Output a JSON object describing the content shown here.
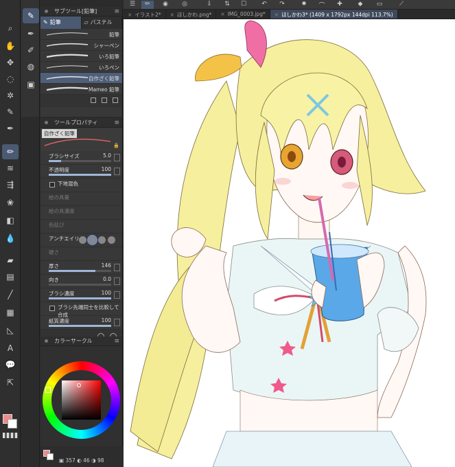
{
  "toolbar": {
    "tools": [
      {
        "icon": "magnifier-icon",
        "glyph": "⌕"
      },
      {
        "icon": "hand-icon",
        "glyph": "✋"
      },
      {
        "icon": "move-icon",
        "glyph": "✥"
      },
      {
        "icon": "lasso-icon",
        "glyph": "◌"
      },
      {
        "icon": "magic-wand-icon",
        "glyph": "✲"
      },
      {
        "icon": "eyedropper-icon",
        "glyph": "✎"
      },
      {
        "icon": "pen-icon",
        "glyph": "✒"
      },
      {
        "icon": "pencil-icon",
        "glyph": "✏"
      },
      {
        "icon": "brush-icon",
        "glyph": "≋"
      },
      {
        "icon": "airbrush-icon",
        "glyph": "⇶"
      },
      {
        "icon": "decoration-icon",
        "glyph": "❀"
      },
      {
        "icon": "eraser-icon",
        "glyph": "◧"
      },
      {
        "icon": "blend-icon",
        "glyph": "💧"
      },
      {
        "icon": "fill-icon",
        "glyph": "▰"
      },
      {
        "icon": "gradient-icon",
        "glyph": "▤"
      },
      {
        "icon": "figure-icon",
        "glyph": "╱"
      },
      {
        "icon": "frame-icon",
        "glyph": "▦"
      },
      {
        "icon": "ruler-icon",
        "glyph": "◺"
      },
      {
        "icon": "text-icon",
        "glyph": "A"
      },
      {
        "icon": "balloon-icon",
        "glyph": "💬"
      },
      {
        "icon": "correct-line-icon",
        "glyph": "⇱"
      }
    ]
  },
  "subtool": {
    "title": "サブツール[鉛筆]",
    "tabs": [
      {
        "label": "鉛筆"
      },
      {
        "label": "パステル"
      }
    ],
    "brushes": [
      {
        "name": "鉛筆"
      },
      {
        "name": "シャーペン"
      },
      {
        "name": "いろ鉛筆"
      },
      {
        "name": "いろペン"
      },
      {
        "name": "自作ざく鉛筆"
      },
      {
        "name": "Mameo 鉛筆"
      }
    ]
  },
  "toolprop": {
    "title": "ツールプロパティ",
    "brush_name": "自作ざく鉛筆",
    "rows": [
      {
        "label": "ブラシサイズ",
        "value": "5.0",
        "fill": 0.2
      },
      {
        "label": "不透明度",
        "value": "100",
        "fill": 1.0
      },
      {
        "label": "下地混色",
        "value": ""
      },
      {
        "label": "絵の具量",
        "value": ""
      },
      {
        "label": "絵の具濃度",
        "value": ""
      },
      {
        "label": "色延び",
        "value": ""
      },
      {
        "label": "アンチエイリ",
        "value": ""
      },
      {
        "label": "硬さ",
        "value": ""
      },
      {
        "label": "厚さ",
        "value": "146",
        "fill": 0.75
      },
      {
        "label": "向き",
        "value": "0.0",
        "fill": 0.0
      },
      {
        "label": "ブラシ濃度",
        "value": "100",
        "fill": 1.0
      },
      {
        "label": "ブラシ先端同士を比較して合成",
        "value": ""
      },
      {
        "label": "紙質濃度",
        "value": "100",
        "fill": 1.0
      }
    ]
  },
  "colorcircle": {
    "title": "カラーサークル",
    "main_color": "#ee8a8a",
    "sub_color": "#ffffff",
    "hsv": [
      "357",
      "46",
      "98"
    ]
  },
  "canvas": {
    "tabs": [
      {
        "label": "イラスト2*"
      },
      {
        "label": "ほしかわ.png*"
      },
      {
        "label": "IMG_0003.jpg*"
      },
      {
        "label": "ほしかわ3* (1409 x 1792px 144dpi 113.7%)"
      }
    ]
  }
}
